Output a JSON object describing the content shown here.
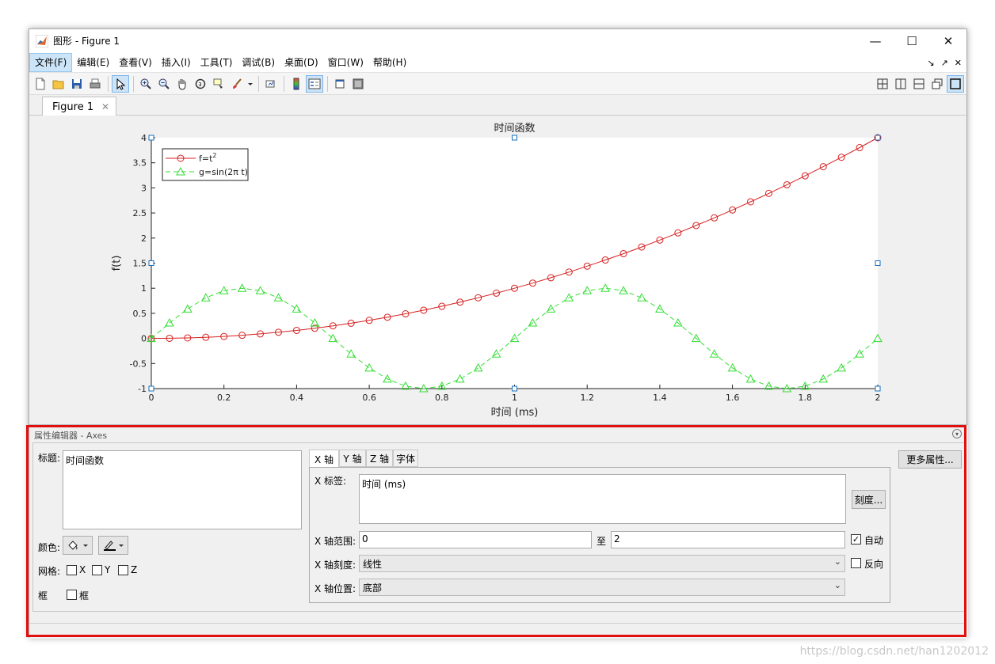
{
  "window": {
    "title": "图形 - Figure 1",
    "minimize": "—",
    "maximize": "☐",
    "close": "✕"
  },
  "menu": {
    "items": [
      "文件(F)",
      "编辑(E)",
      "查看(V)",
      "插入(I)",
      "工具(T)",
      "调试(B)",
      "桌面(D)",
      "窗口(W)",
      "帮助(H)"
    ],
    "right_icons": [
      "↘",
      "↗",
      "✕"
    ]
  },
  "toolbar": {
    "icons": [
      "new-figure-icon",
      "open-file-icon",
      "save-icon",
      "print-icon",
      "select-arrow-icon",
      "zoom-in-icon",
      "zoom-out-icon",
      "pan-hand-icon",
      "rotate-3d-icon",
      "data-cursor-icon",
      "brush-icon",
      "link-plot-icon",
      "colorbar-icon",
      "legend-icon",
      "hide-tools-icon",
      "show-tools-icon"
    ],
    "layout_icons": [
      "tile-grid-icon",
      "split-vertical-icon",
      "split-horizontal-icon",
      "float-window-icon",
      "maximize-pane-icon"
    ]
  },
  "tabs": {
    "figure_tab": "Figure 1",
    "close": "✕"
  },
  "chart_data": {
    "type": "line",
    "title": "时间函数",
    "xlabel": "时间 (ms)",
    "ylabel": "f(t)",
    "xlim": [
      0,
      2
    ],
    "ylim": [
      -1,
      4
    ],
    "xticks": [
      "0",
      "0.2",
      "0.4",
      "0.6",
      "0.8",
      "1",
      "1.2",
      "1.4",
      "1.6",
      "1.8",
      "2"
    ],
    "yticks": [
      "-1",
      "-0.5",
      "0",
      "0.5",
      "1",
      "1.5",
      "2",
      "2.5",
      "3",
      "3.5",
      "4"
    ],
    "grid": false,
    "legend_position": "top-left",
    "x": [
      0,
      0.05,
      0.1,
      0.15,
      0.2,
      0.25,
      0.3,
      0.35,
      0.4,
      0.45,
      0.5,
      0.55,
      0.6,
      0.65,
      0.7,
      0.75,
      0.8,
      0.85,
      0.9,
      0.95,
      1.0,
      1.05,
      1.1,
      1.15,
      1.2,
      1.25,
      1.3,
      1.35,
      1.4,
      1.45,
      1.5,
      1.55,
      1.6,
      1.65,
      1.7,
      1.75,
      1.8,
      1.85,
      1.9,
      1.95,
      2.0
    ],
    "series": [
      {
        "name": "f=t²",
        "name_base": "f=t",
        "name_sup": "2",
        "color": "#d62020",
        "marker": "circle",
        "style": "solid",
        "values": [
          0,
          0.0025,
          0.01,
          0.0225,
          0.04,
          0.0625,
          0.09,
          0.1225,
          0.16,
          0.2025,
          0.25,
          0.3025,
          0.36,
          0.4225,
          0.49,
          0.5625,
          0.64,
          0.7225,
          0.81,
          0.9025,
          1.0,
          1.1025,
          1.21,
          1.3225,
          1.44,
          1.5625,
          1.69,
          1.8225,
          1.96,
          2.1025,
          2.25,
          2.4025,
          2.56,
          2.7225,
          2.89,
          3.0625,
          3.24,
          3.4225,
          3.61,
          3.8025,
          4.0
        ]
      },
      {
        "name": "g=sin(2π t)",
        "color": "#33dd33",
        "marker": "triangle",
        "style": "dashed",
        "values": [
          0,
          0.309,
          0.588,
          0.809,
          0.951,
          1.0,
          0.951,
          0.809,
          0.588,
          0.309,
          0,
          -0.309,
          -0.588,
          -0.809,
          -0.951,
          -1.0,
          -0.951,
          -0.809,
          -0.588,
          -0.309,
          0,
          0.309,
          0.588,
          0.809,
          0.951,
          1.0,
          0.951,
          0.809,
          0.588,
          0.309,
          0,
          -0.309,
          -0.588,
          -0.809,
          -0.951,
          -1.0,
          -0.951,
          -0.809,
          -0.588,
          -0.309,
          0
        ]
      }
    ]
  },
  "property_editor": {
    "header": "属性编辑器 - Axes",
    "title_label": "标题:",
    "title_value": "时间函数",
    "color_label": "颜色:",
    "grid_label": "网格:",
    "grid_x": "X",
    "grid_y": "Y",
    "grid_z": "Z",
    "box_label": "框",
    "box_check_label": "框",
    "subtabs": [
      "X 轴",
      "Y 轴",
      "Z 轴",
      "字体"
    ],
    "x_label_label": "X 标签:",
    "x_label_value": "时间 (ms)",
    "ticks_button": "刻度...",
    "x_range_label": "X 轴范围:",
    "x_range_min": "0",
    "x_range_to": "至",
    "x_range_max": "2",
    "auto_label": "自动",
    "x_scale_label": "X 轴刻度:",
    "x_scale_value": "线性",
    "reverse_label": "反向",
    "x_location_label": "X 轴位置:",
    "x_location_value": "底部",
    "more_props_button": "更多属性...",
    "auto_checked": true
  },
  "watermark": "https://blog.csdn.net/han1202012"
}
